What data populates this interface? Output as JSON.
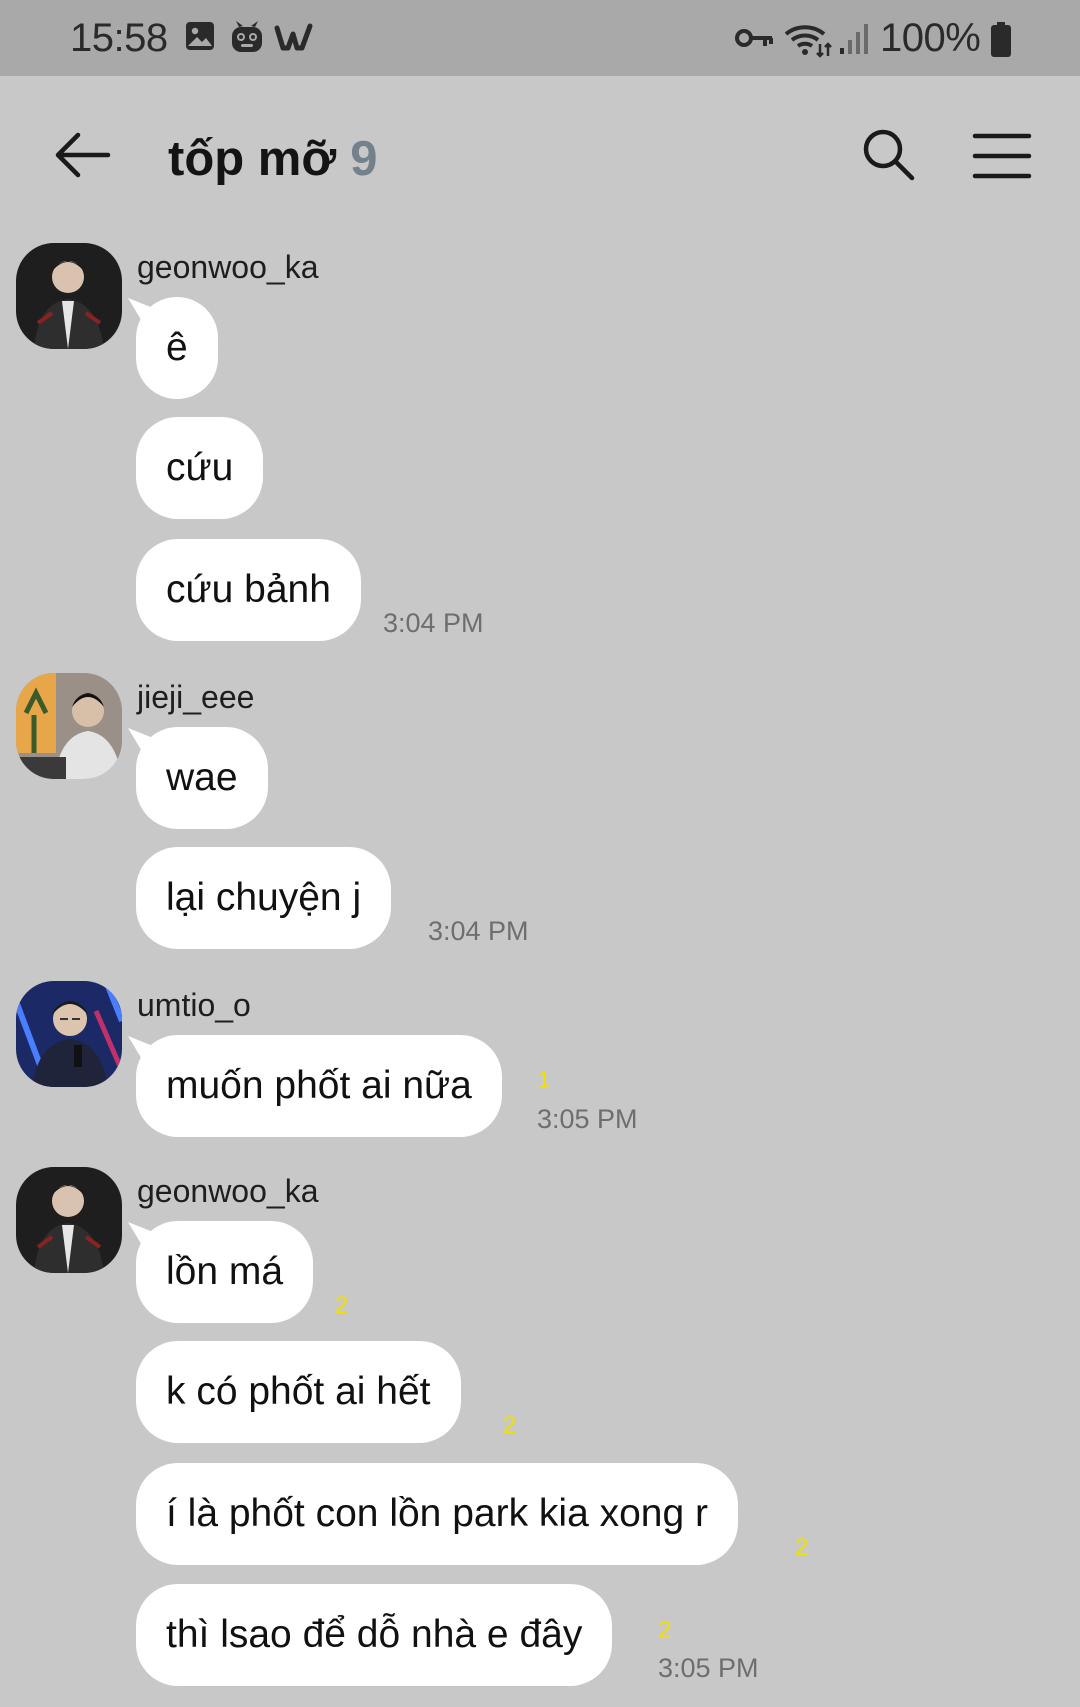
{
  "status_bar": {
    "time": "15:58",
    "battery": "100%",
    "icons": [
      "gallery-icon",
      "app-mascot-icon",
      "webtoon-w-icon",
      "vpn-key-icon",
      "wifi-icon",
      "signal-icon",
      "battery-icon"
    ]
  },
  "header": {
    "title": "tốp mỡ",
    "member_count": "9"
  },
  "colors": {
    "background": "#c8c8c8",
    "status_bar": "#a9a9a9",
    "bubble": "#ffffff",
    "unread": "#f0e000",
    "member_count": "#74808c"
  },
  "groups": [
    {
      "sender": "geonwoo_ka",
      "messages": [
        {
          "text": "ê"
        },
        {
          "text": "cứu"
        },
        {
          "text": "cứu bảnh",
          "time": "3:04 PM"
        }
      ]
    },
    {
      "sender": "jieji_eee",
      "messages": [
        {
          "text": "wae"
        },
        {
          "text": "lại chuyện j",
          "time": "3:04 PM"
        }
      ]
    },
    {
      "sender": "umtio_o",
      "messages": [
        {
          "text": "muốn phốt ai nữa",
          "unread": "1",
          "time": "3:05 PM"
        }
      ]
    },
    {
      "sender": "geonwoo_ka",
      "messages": [
        {
          "text": "lồn má",
          "unread": "2"
        },
        {
          "text": "k có phốt ai hết",
          "unread": "2"
        },
        {
          "text": "í là phốt con lồn park kia xong r",
          "unread": "2"
        },
        {
          "text": "thì lsao để dỗ nhà e đây",
          "unread": "2",
          "time": "3:05 PM"
        }
      ]
    }
  ]
}
